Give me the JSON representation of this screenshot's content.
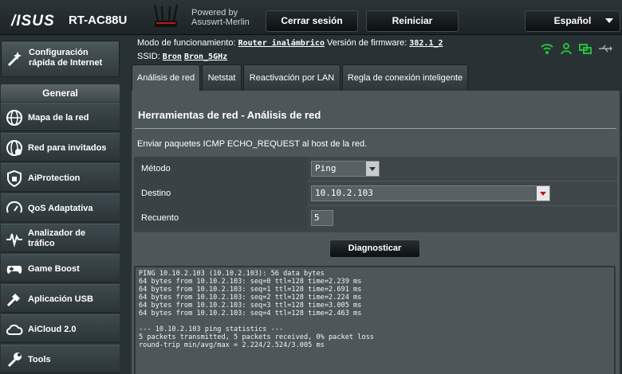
{
  "header": {
    "brand": "/ISUS",
    "model": "RT-AC88U",
    "powered_by": "Powered by",
    "firmware_name": "Asuswrt-Merlin",
    "logout_label": "Cerrar sesión",
    "reboot_label": "Reiniciar",
    "language_label": "Español"
  },
  "status": {
    "mode_label": "Modo de funcionamiento:",
    "mode_value": "Router inalámbrico",
    "firmware_label": "Versión de firmware:",
    "firmware_value": "382.1_2",
    "ssid_label": "SSID:",
    "ssid_1": "Bron",
    "ssid_2": "Bron_5GHz",
    "icons": [
      "wifi-icon",
      "user-icon",
      "network-icon",
      "usb-icon"
    ],
    "icon_color": "#25c13b"
  },
  "sidebar": {
    "quick_setup_line1": "Configuración",
    "quick_setup_line2": "rápida de Internet",
    "general_label": "General",
    "items": [
      {
        "line1": "Mapa de la red",
        "line2": ""
      },
      {
        "line1": "Red para invitados",
        "line2": ""
      },
      {
        "line1": "AiProtection",
        "line2": ""
      },
      {
        "line1": "QoS Adaptativa",
        "line2": ""
      },
      {
        "line1": "Analizador de",
        "line2": "tráfico"
      },
      {
        "line1": "Game Boost",
        "line2": ""
      },
      {
        "line1": "Aplicación USB",
        "line2": ""
      },
      {
        "line1": "AiCloud 2.0",
        "line2": ""
      },
      {
        "line1": "Tools",
        "line2": ""
      }
    ]
  },
  "tabs": [
    {
      "label": "Análisis de red",
      "active": true
    },
    {
      "label": "Netstat",
      "active": false
    },
    {
      "label": "Reactivación por LAN",
      "active": false
    },
    {
      "label": "Regla de conexión inteligente",
      "active": false
    }
  ],
  "panel": {
    "title": "Herramientas de red - Análisis de red",
    "description": "Enviar paquetes ICMP ECHO_REQUEST al host de la red.",
    "method_label": "Método",
    "method_value": "Ping",
    "destination_label": "Destino",
    "destination_value": "10.10.2.103",
    "count_label": "Recuento",
    "count_value": "5",
    "diagnose_label": "Diagnosticar",
    "output": "PING 10.10.2.103 (10.10.2.103): 56 data bytes\n64 bytes from 10.10.2.103: seq=0 ttl=128 time=2.239 ms\n64 bytes from 10.10.2.103: seq=1 ttl=128 time=2.691 ms\n64 bytes from 10.10.2.103: seq=2 ttl=128 time=2.224 ms\n64 bytes from 10.10.2.103: seq=3 ttl=128 time=3.005 ms\n64 bytes from 10.10.2.103: seq=4 ttl=128 time=2.463 ms\n\n--- 10.10.2.103 ping statistics ---\n5 packets transmitted, 5 packets received, 0% packet loss\nround-trip min/avg/max = 2.224/2.524/3.005 ms"
  }
}
